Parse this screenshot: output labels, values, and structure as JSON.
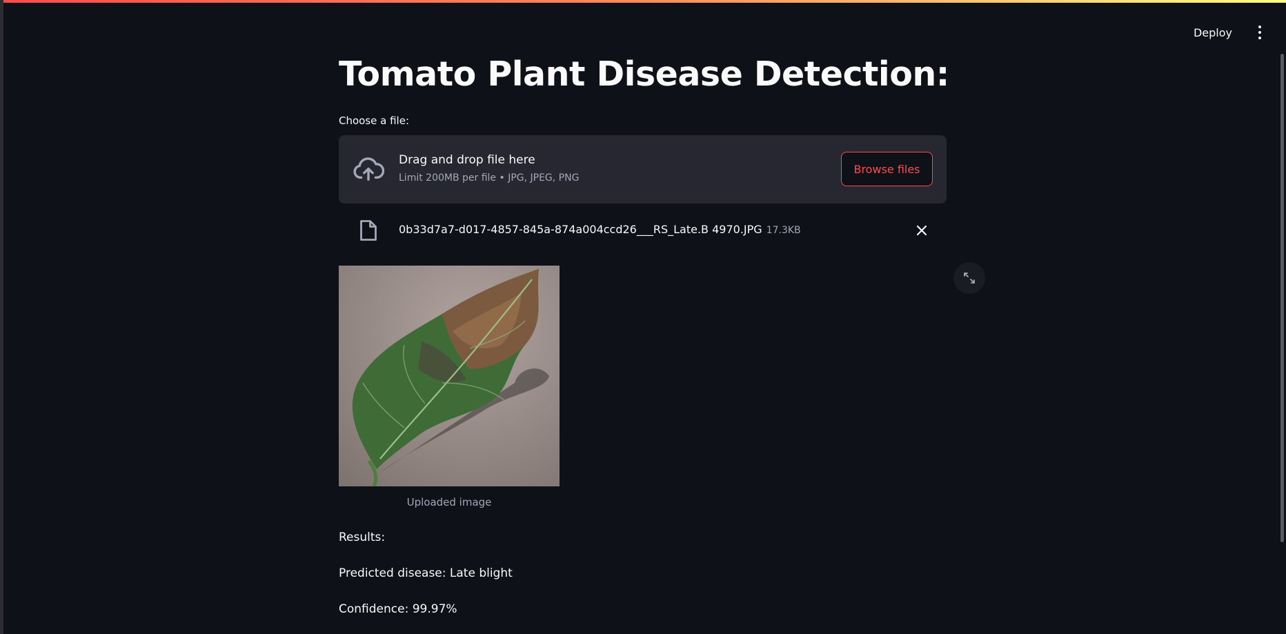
{
  "toolbar": {
    "deploy_label": "Deploy",
    "menu_icon": "vertical-dots-icon"
  },
  "page": {
    "title": "Tomato Plant Disease Detection:"
  },
  "uploader": {
    "label": "Choose a file:",
    "drop_title": "Drag and drop file here",
    "limit_text": "Limit 200MB per file • JPG, JPEG, PNG",
    "browse_label": "Browse files",
    "icon": "cloud-upload-icon"
  },
  "uploaded_file": {
    "name": "0b33d7a7-d017-4857-845a-874a004ccd26___RS_Late.B 4970.JPG",
    "size": "17.3KB",
    "icon": "file-icon"
  },
  "image": {
    "caption": "Uploaded image"
  },
  "results": {
    "heading": "Results:",
    "disease": "Predicted disease: Late blight",
    "confidence": "Confidence: 99.97%"
  },
  "colors": {
    "background": "#0e1117",
    "dropzone": "#262730",
    "accent": "#ff4b4b",
    "muted_text": "#a3a8b8"
  }
}
